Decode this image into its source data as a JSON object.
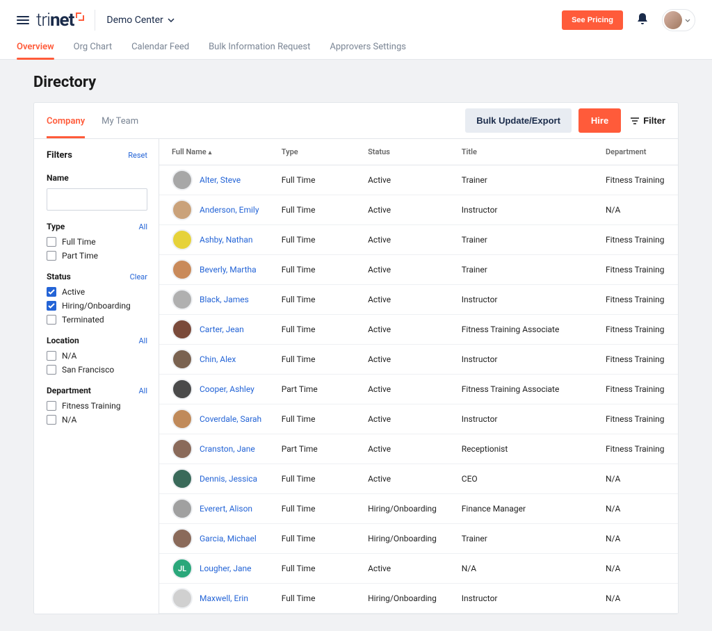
{
  "header": {
    "brand_left": "tri",
    "brand_right": "net",
    "demo_center": "Demo Center",
    "see_pricing": "See Pricing"
  },
  "main_tabs": [
    {
      "label": "Overview",
      "active": true
    },
    {
      "label": "Org Chart",
      "active": false
    },
    {
      "label": "Calendar Feed",
      "active": false
    },
    {
      "label": "Bulk Information Request",
      "active": false
    },
    {
      "label": "Approvers Settings",
      "active": false
    }
  ],
  "page_title": "Directory",
  "card_tabs": [
    {
      "label": "Company",
      "active": true
    },
    {
      "label": "My Team",
      "active": false
    }
  ],
  "actions": {
    "bulk": "Bulk Update/Export",
    "hire": "Hire",
    "filter": "Filter"
  },
  "filters": {
    "title": "Filters",
    "reset": "Reset",
    "name_label": "Name",
    "name_value": "",
    "type": {
      "label": "Type",
      "link": "All",
      "options": [
        {
          "label": "Full Time",
          "checked": false
        },
        {
          "label": "Part Time",
          "checked": false
        }
      ]
    },
    "status": {
      "label": "Status",
      "link": "Clear",
      "options": [
        {
          "label": "Active",
          "checked": true
        },
        {
          "label": "Hiring/Onboarding",
          "checked": true
        },
        {
          "label": "Terminated",
          "checked": false
        }
      ]
    },
    "location": {
      "label": "Location",
      "link": "All",
      "options": [
        {
          "label": "N/A",
          "checked": false
        },
        {
          "label": "San Francisco",
          "checked": false
        }
      ]
    },
    "department": {
      "label": "Department",
      "link": "All",
      "options": [
        {
          "label": "Fitness Training",
          "checked": false
        },
        {
          "label": "N/A",
          "checked": false
        }
      ]
    }
  },
  "columns": {
    "full_name": "Full Name",
    "type": "Type",
    "status": "Status",
    "title": "Title",
    "department": "Department"
  },
  "rows": [
    {
      "name": "Alter, Steve",
      "type": "Full Time",
      "status": "Active",
      "title": "Trainer",
      "department": "Fitness Training",
      "av": "#a7a7a7"
    },
    {
      "name": "Anderson, Emily",
      "type": "Full Time",
      "status": "Active",
      "title": "Instructor",
      "department": "N/A",
      "av": "#caa27a"
    },
    {
      "name": "Ashby, Nathan",
      "type": "Full Time",
      "status": "Active",
      "title": "Trainer",
      "department": "Fitness Training",
      "av": "#e6d23a"
    },
    {
      "name": "Beverly, Martha",
      "type": "Full Time",
      "status": "Active",
      "title": "Trainer",
      "department": "Fitness Training",
      "av": "#c98a5a"
    },
    {
      "name": "Black, James",
      "type": "Full Time",
      "status": "Active",
      "title": "Instructor",
      "department": "Fitness Training",
      "av": "#b0b0b0"
    },
    {
      "name": "Carter, Jean",
      "type": "Full Time",
      "status": "Active",
      "title": "Fitness Training Associate",
      "department": "Fitness Training",
      "av": "#7a4a3a"
    },
    {
      "name": "Chin, Alex",
      "type": "Full Time",
      "status": "Active",
      "title": "Instructor",
      "department": "Fitness Training",
      "av": "#7a6250"
    },
    {
      "name": "Cooper, Ashley",
      "type": "Part Time",
      "status": "Active",
      "title": "Fitness Training Associate",
      "department": "Fitness Training",
      "av": "#4a4a4a"
    },
    {
      "name": "Coverdale, Sarah",
      "type": "Full Time",
      "status": "Active",
      "title": "Instructor",
      "department": "Fitness Training",
      "av": "#c08a5a"
    },
    {
      "name": "Cranston, Jane",
      "type": "Part Time",
      "status": "Active",
      "title": "Receptionist",
      "department": "Fitness Training",
      "av": "#8a6a5a"
    },
    {
      "name": "Dennis, Jessica",
      "type": "Full Time",
      "status": "Active",
      "title": "CEO",
      "department": "N/A",
      "av": "#3a6a5a"
    },
    {
      "name": "Everert, Alison",
      "type": "Full Time",
      "status": "Hiring/Onboarding",
      "title": "Finance Manager",
      "department": "N/A",
      "av": "#a0a0a0"
    },
    {
      "name": "Garcia, Michael",
      "type": "Full Time",
      "status": "Hiring/Onboarding",
      "title": "Trainer",
      "department": "N/A",
      "av": "#8a6a5a"
    },
    {
      "name": "Lougher, Jane",
      "type": "Full Time",
      "status": "Active",
      "title": "N/A",
      "department": "N/A",
      "av": "#2aa77a",
      "initials": "JL"
    },
    {
      "name": "Maxwell, Erin",
      "type": "Full Time",
      "status": "Hiring/Onboarding",
      "title": "Instructor",
      "department": "N/A",
      "av": "#d0d0d0"
    }
  ]
}
